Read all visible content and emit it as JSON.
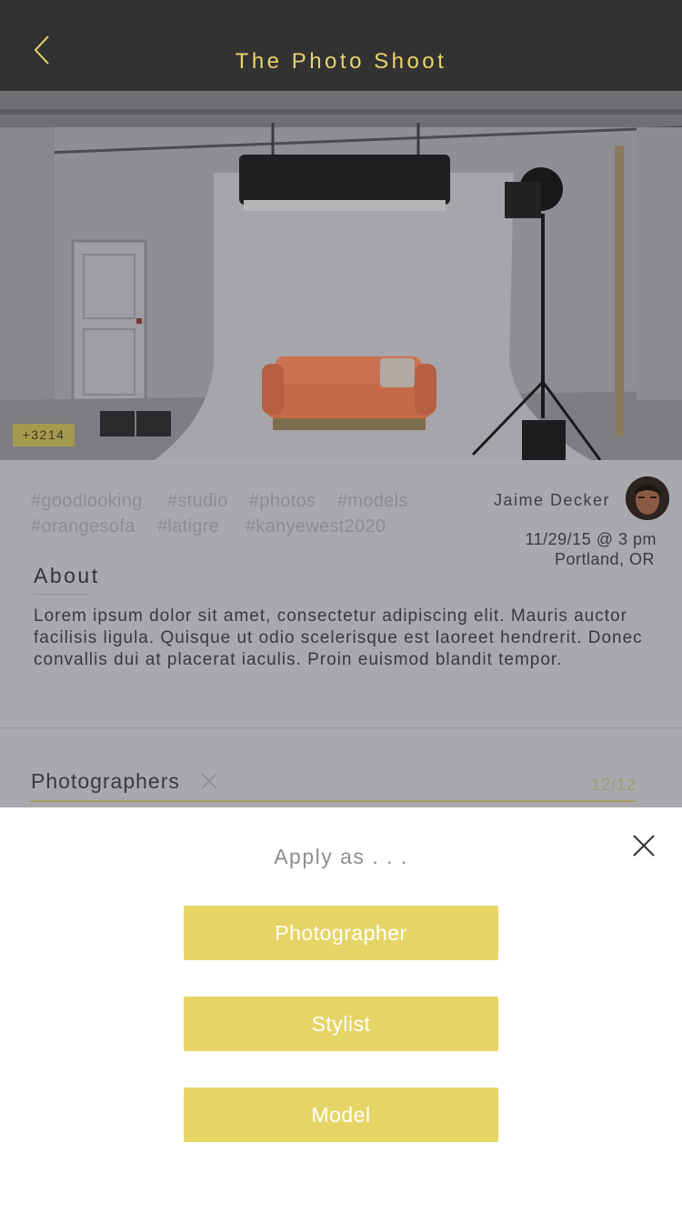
{
  "header": {
    "title": "The Photo Shoot"
  },
  "hero": {
    "count_badge": "+3214"
  },
  "tags": [
    "#goodlooking",
    "#studio",
    "#photos",
    "#models",
    "#orangesofa",
    "#latigre",
    "#kanyewest2020"
  ],
  "host": {
    "name": "Jaime Decker",
    "date": "11/29/15 @ 3 pm",
    "location": "Portland, OR"
  },
  "about": {
    "title": "About",
    "text": "Lorem ipsum dolor sit amet, consectetur adipiscing elit. Mauris auctor facilisis ligula. Quisque ut odio scelerisque est laoreet hendrerit. Donec convallis dui at placerat iaculis. Proin euismod blandit tempor."
  },
  "role": {
    "label": "Photographers",
    "count": "12/12"
  },
  "sheet": {
    "title": "Apply as . . .",
    "options": [
      "Photographer",
      "Stylist",
      "Model"
    ]
  },
  "colors": {
    "accent": "#e6d566",
    "header_bg": "#333232",
    "title": "#e8d56a",
    "overlay": "#a9a9ad"
  },
  "icons": {
    "back": "chevron-left-icon",
    "close": "close-icon",
    "remove": "x-icon"
  }
}
